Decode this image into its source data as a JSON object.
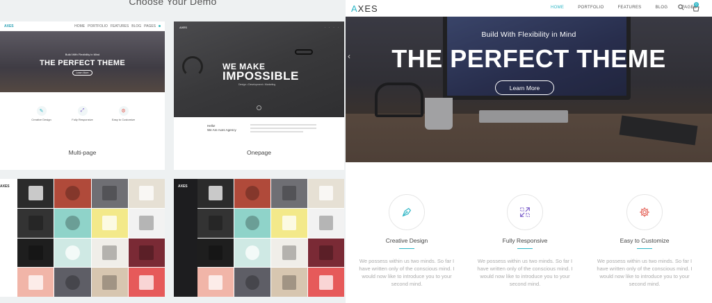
{
  "chooser": {
    "title": "Choose Your Demo",
    "demos": [
      {
        "label": "Multi-page",
        "thumb": {
          "logo": "AXES",
          "nav": [
            "HOME",
            "PORTFOLIO",
            "FEATURES",
            "BLOG",
            "PAGES"
          ],
          "tagline": "Build With Flexibility in Mind",
          "headline": "THE PERFECT THEME",
          "cta": "Learn More",
          "features": [
            "Creative Design",
            "Fully Responsive",
            "Easy to Customize"
          ]
        }
      },
      {
        "label": "Onepage",
        "thumb": {
          "logo": "AXES",
          "line1": "WE MAKE",
          "line2": "IMPOSSIBLE",
          "line3": "Design  •  Development  •  Marketing",
          "hello": "Hello!",
          "agency": "We Are Axes Agency"
        }
      },
      {
        "label": "",
        "thumb": {
          "logo": "AXES"
        }
      },
      {
        "label": "",
        "thumb": {
          "logo": "AXES"
        }
      }
    ]
  },
  "preview": {
    "brand": {
      "accent": "A",
      "rest": "XES"
    },
    "nav": [
      "HOME",
      "PORTFOLIO",
      "FEATURES",
      "BLOG",
      "PAGES"
    ],
    "active_nav": "HOME",
    "cart_count": "0",
    "icons": {
      "search": "search-icon",
      "cart": "cart-icon",
      "prev": "chevron-left-icon"
    },
    "hero": {
      "tagline": "Build With Flexibility in Mind",
      "headline": "THE PERFECT THEME",
      "cta": "Learn More"
    },
    "features": [
      {
        "icon": "pen-icon",
        "title": "Creative Design",
        "desc": "We possess within us two minds. So far I have written only of the conscious mind. I would now like to introduce you to your second mind."
      },
      {
        "icon": "expand-arrows-icon",
        "title": "Fully Responsive",
        "desc": "We possess within us two minds. So far I have written only of the conscious mind. I would now like to introduce you to your second mind."
      },
      {
        "icon": "gear-icon",
        "title": "Easy to Customize",
        "desc": "We possess within us two minds. So far I have written only of the conscious mind. I would now like to introduce you to your second mind."
      }
    ]
  },
  "colors": {
    "accent": "#2bb5c5",
    "panel_bg": "#eef1f2",
    "text": "#444444",
    "muted": "#aaaaaa"
  }
}
